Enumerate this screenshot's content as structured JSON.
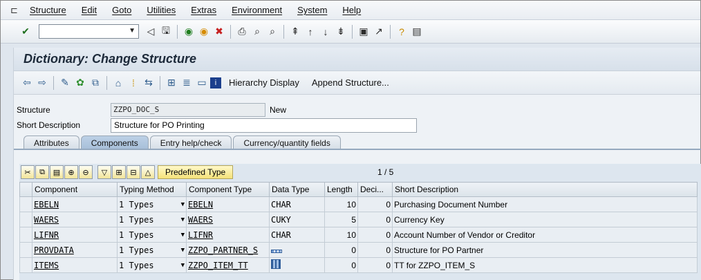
{
  "menu": {
    "items": [
      "Structure",
      "Edit",
      "Goto",
      "Utilities",
      "Extras",
      "Environment",
      "System",
      "Help"
    ]
  },
  "systoolbar": {
    "command_field": ""
  },
  "title": "Dictionary: Change Structure",
  "app_toolbar": {
    "hierarchy_display": "Hierarchy Display",
    "append_structure": "Append Structure..."
  },
  "form": {
    "structure_label": "Structure",
    "structure_value": "ZZPO_DOC_S",
    "status": "New",
    "short_desc_label": "Short Description",
    "short_desc_value": "Structure for PO Printing"
  },
  "tabs": [
    "Attributes",
    "Components",
    "Entry help/check",
    "Currency/quantity fields"
  ],
  "table": {
    "predefined_type": "Predefined Type",
    "pager": "1 / 5",
    "headers": [
      "Component",
      "Typing Method",
      "Component Type",
      "Data Type",
      "Length",
      "Deci...",
      "Short Description"
    ],
    "rows": [
      {
        "component": "EBELN",
        "typing": "1 Types",
        "comp_type": "EBELN",
        "data_type": "CHAR",
        "length": "10",
        "deci": "0",
        "desc": "Purchasing Document Number"
      },
      {
        "component": "WAERS",
        "typing": "1 Types",
        "comp_type": "WAERS",
        "data_type": "CUKY",
        "length": "5",
        "deci": "0",
        "desc": "Currency Key"
      },
      {
        "component": "LIFNR",
        "typing": "1 Types",
        "comp_type": "LIFNR",
        "data_type": "CHAR",
        "length": "10",
        "deci": "0",
        "desc": "Account Number of Vendor or Creditor"
      },
      {
        "component": "PROVDATA",
        "typing": "1 Types",
        "comp_type": "ZZPO_PARTNER_S",
        "data_type": "",
        "length": "0",
        "deci": "0",
        "desc": "Structure for PO Partner"
      },
      {
        "component": "ITEMS",
        "typing": "1 Types",
        "comp_type": "ZZPO_ITEM_TT",
        "data_type": "",
        "length": "0",
        "deci": "0",
        "desc": "TT for ZZPO_ITEM_S"
      }
    ]
  }
}
